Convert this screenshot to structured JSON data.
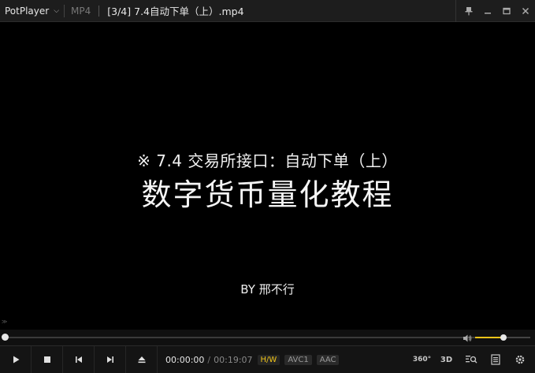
{
  "titlebar": {
    "brand": "PotPlayer",
    "format": "MP4",
    "file_title": "[3/4] 7.4自动下单（上）.mp4"
  },
  "video": {
    "subtitle_line1": "※ 7.4 交易所接口：自动下单（上）",
    "subtitle_line2": "数字货币量化教程",
    "subtitle_line3": "BY 邢不行"
  },
  "playback": {
    "position_fraction": 0.0,
    "volume_fraction": 0.52
  },
  "controls": {
    "current_time": "00:00:00",
    "total_time": "00:19:07",
    "hw_label": "H/W",
    "video_codec": "AVC1",
    "audio_codec": "AAC",
    "btn_360": "360°",
    "btn_3d": "3D"
  },
  "colors": {
    "accent": "#f0c419",
    "background": "#000000",
    "bar": "#141414"
  }
}
